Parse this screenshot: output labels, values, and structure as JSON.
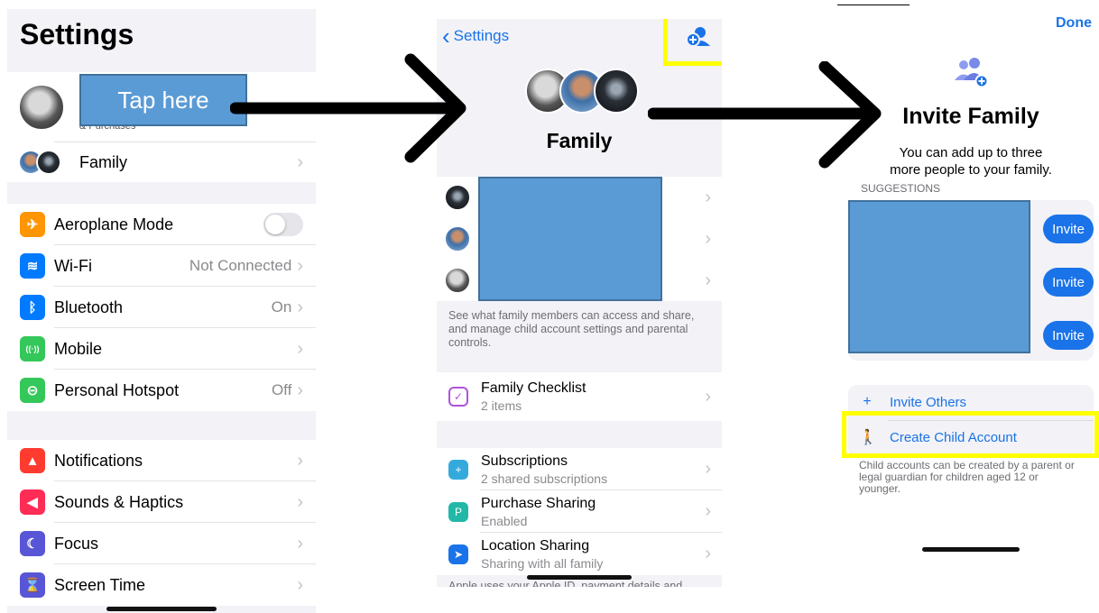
{
  "settings": {
    "title": "Settings",
    "profile_sub": "& Purchases",
    "tap_label": "Tap here",
    "family_label": "Family",
    "connectivity": [
      {
        "label": "Aeroplane Mode",
        "value": "",
        "icon": "airplane-icon",
        "color": "#ff9500",
        "glyph": "✈"
      },
      {
        "label": "Wi-Fi",
        "value": "Not Connected",
        "icon": "wifi-icon",
        "color": "#007aff",
        "glyph": "≋"
      },
      {
        "label": "Bluetooth",
        "value": "On",
        "icon": "bluetooth-icon",
        "color": "#007aff",
        "glyph": "ᛒ"
      },
      {
        "label": "Mobile",
        "value": "",
        "icon": "antenna-icon",
        "color": "#34c759",
        "glyph": "((·))"
      },
      {
        "label": "Personal Hotspot",
        "value": "Off",
        "icon": "hotspot-icon",
        "color": "#34c759",
        "glyph": "⊝"
      }
    ],
    "notifications": [
      {
        "label": "Notifications",
        "icon": "notification-bell-icon",
        "color": "#ff3b30",
        "glyph": "▲"
      },
      {
        "label": "Sounds & Haptics",
        "icon": "speaker-icon",
        "color": "#ff2d55",
        "glyph": "◀"
      },
      {
        "label": "Focus",
        "icon": "moon-icon",
        "color": "#5856d6",
        "glyph": "☾"
      },
      {
        "label": "Screen Time",
        "icon": "hourglass-icon",
        "color": "#5856d6",
        "glyph": "⌛"
      }
    ]
  },
  "family": {
    "back_label": "Settings",
    "title": "Family",
    "note": "See what family members can access and share, and manage child account settings and parental controls.",
    "checklist": {
      "title": "Family Checklist",
      "sub": "2 items"
    },
    "services": [
      {
        "title": "Subscriptions",
        "sub": "2 shared subscriptions",
        "icon": "subscriptions-icon",
        "color": "#34aadc",
        "glyph": "+"
      },
      {
        "title": "Purchase Sharing",
        "sub": "Enabled",
        "icon": "purchase-sharing-icon",
        "color": "#22b8a7",
        "glyph": "P"
      },
      {
        "title": "Location Sharing",
        "sub": "Sharing with all family",
        "icon": "location-arrow-icon",
        "color": "#1a73e8",
        "glyph": "➤"
      }
    ],
    "footer_cut": "Apple uses your Apple ID, payment details and"
  },
  "invite": {
    "done_label": "Done",
    "title": "Invite Family",
    "subtitle_line1": "You can add up to three",
    "subtitle_line2": "more people to your family.",
    "suggestions_label": "SUGGESTIONS",
    "invite_label": "Invite",
    "invite_others": "Invite Others",
    "create_child": "Create Child Account",
    "child_note": "Child accounts can be created by a parent or legal guardian for children aged 12 or younger."
  },
  "colors": {
    "accent": "#1a73e8",
    "highlight": "#ffff00",
    "redaction": "#5b9bd5"
  }
}
